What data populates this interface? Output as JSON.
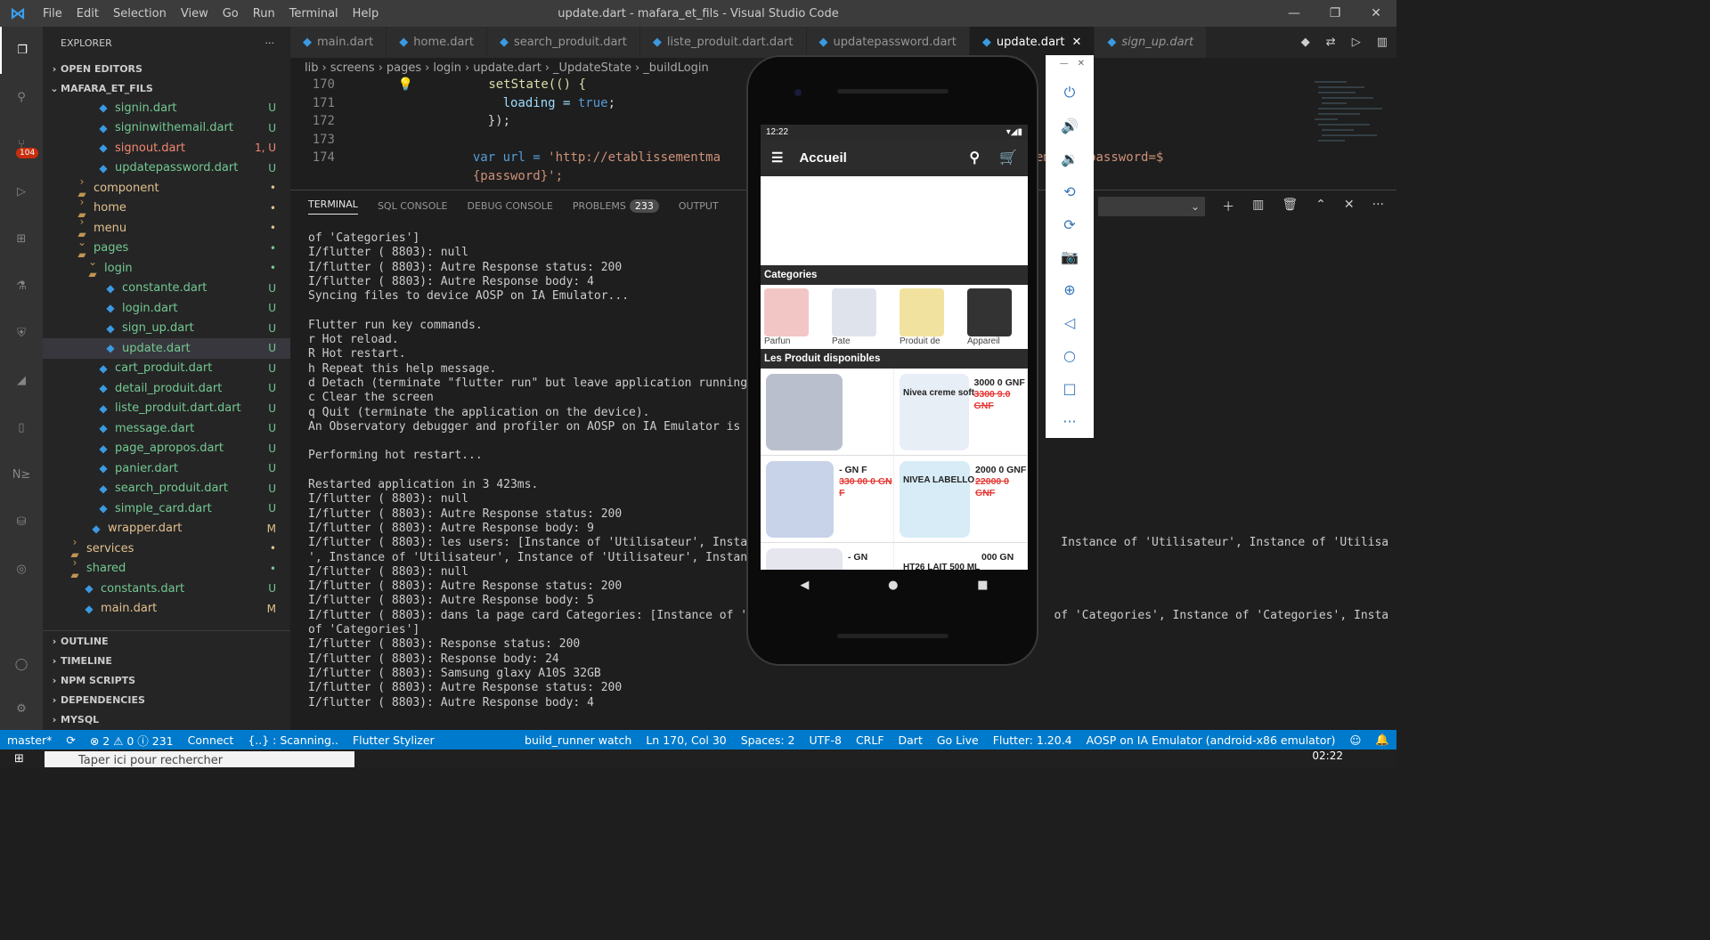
{
  "window": {
    "title": "update.dart - mafara_et_fils - Visual Studio Code",
    "menu": [
      "File",
      "Edit",
      "Selection",
      "View",
      "Go",
      "Run",
      "Terminal",
      "Help"
    ]
  },
  "activity": {
    "scm_badge": "104"
  },
  "explorer": {
    "header": "EXPLORER",
    "open_editors": "OPEN EDITORS",
    "project": "MAFARA_ET_FILS",
    "rows": [
      {
        "label": "signin.dart",
        "indent": 60,
        "type": "dart",
        "status": "U",
        "cls": "untracked"
      },
      {
        "label": "signinwithemail.dart",
        "indent": 60,
        "type": "dart",
        "status": "U",
        "cls": "untracked"
      },
      {
        "label": "signout.dart",
        "indent": 60,
        "type": "dart",
        "status": "1, U",
        "cls": "err"
      },
      {
        "label": "updatepassword.dart",
        "indent": 60,
        "type": "dart",
        "status": "U",
        "cls": "untracked"
      },
      {
        "label": "component",
        "indent": 36,
        "type": "folder",
        "status": "•",
        "cls": "modified"
      },
      {
        "label": "home",
        "indent": 36,
        "type": "folder",
        "status": "•",
        "cls": "modified"
      },
      {
        "label": "menu",
        "indent": 36,
        "type": "folder",
        "status": "•",
        "cls": "modified"
      },
      {
        "label": "pages",
        "indent": 36,
        "type": "folder-open",
        "status": "•",
        "cls": "untracked"
      },
      {
        "label": "login",
        "indent": 48,
        "type": "folder-open",
        "status": "•",
        "cls": "untracked"
      },
      {
        "label": "constante.dart",
        "indent": 68,
        "type": "dart",
        "status": "U",
        "cls": "untracked"
      },
      {
        "label": "login.dart",
        "indent": 68,
        "type": "dart",
        "status": "U",
        "cls": "untracked"
      },
      {
        "label": "sign_up.dart",
        "indent": 68,
        "type": "dart",
        "status": "U",
        "cls": "untracked"
      },
      {
        "label": "update.dart",
        "indent": 68,
        "type": "dart",
        "status": "U",
        "cls": "untracked",
        "selected": true
      },
      {
        "label": "cart_produit.dart",
        "indent": 60,
        "type": "dart",
        "status": "U",
        "cls": "untracked"
      },
      {
        "label": "detail_produit.dart",
        "indent": 60,
        "type": "dart",
        "status": "U",
        "cls": "untracked"
      },
      {
        "label": "liste_produit.dart.dart",
        "indent": 60,
        "type": "dart",
        "status": "U",
        "cls": "untracked"
      },
      {
        "label": "message.dart",
        "indent": 60,
        "type": "dart",
        "status": "U",
        "cls": "untracked"
      },
      {
        "label": "page_apropos.dart",
        "indent": 60,
        "type": "dart",
        "status": "U",
        "cls": "untracked"
      },
      {
        "label": "panier.dart",
        "indent": 60,
        "type": "dart",
        "status": "U",
        "cls": "untracked"
      },
      {
        "label": "search_produit.dart",
        "indent": 60,
        "type": "dart",
        "status": "U",
        "cls": "untracked"
      },
      {
        "label": "simple_card.dart",
        "indent": 60,
        "type": "dart",
        "status": "U",
        "cls": "untracked"
      },
      {
        "label": "wrapper.dart",
        "indent": 52,
        "type": "dart",
        "status": "M",
        "cls": "modified"
      },
      {
        "label": "services",
        "indent": 28,
        "type": "folder",
        "status": "•",
        "cls": "modified"
      },
      {
        "label": "shared",
        "indent": 28,
        "type": "folder",
        "status": "•",
        "cls": "untracked"
      },
      {
        "label": "constants.dart",
        "indent": 44,
        "type": "dart",
        "status": "U",
        "cls": "untracked"
      },
      {
        "label": "main.dart",
        "indent": 44,
        "type": "dart",
        "status": "M",
        "cls": "modified"
      }
    ],
    "bottom_sections": [
      "OUTLINE",
      "TIMELINE",
      "NPM SCRIPTS",
      "DEPENDENCIES",
      "MYSQL"
    ]
  },
  "tabs": [
    {
      "label": "main.dart",
      "active": false,
      "italic": false
    },
    {
      "label": "home.dart",
      "active": false,
      "italic": false
    },
    {
      "label": "search_produit.dart",
      "active": false,
      "italic": false
    },
    {
      "label": "liste_produit.dart.dart",
      "active": false,
      "italic": false
    },
    {
      "label": "updatepassword.dart",
      "active": false,
      "italic": false
    },
    {
      "label": "update.dart",
      "active": true,
      "italic": false
    },
    {
      "label": "sign_up.dart",
      "active": false,
      "italic": true
    }
  ],
  "breadcrumb": [
    "lib",
    "screens",
    "pages",
    "login",
    "update.dart",
    "_UpdateState",
    "_buildLogin"
  ],
  "code": {
    "lines": [
      "170",
      "171",
      "172",
      "173",
      "174"
    ],
    "l170": "setState(() {",
    "l171a": "loading = ",
    "l171b": "true",
    "l172": "});",
    "l174a": "var url = ",
    "l174b": "'http://etablissementma",
    "l174c": "il=${email}&password=$",
    "l175": "{password}';"
  },
  "panel": {
    "tabs": [
      "TERMINAL",
      "SQL CONSOLE",
      "DEBUG CONSOLE",
      "PROBLEMS",
      "OUTPUT"
    ],
    "problems_count": "233"
  },
  "terminal": [
    "of 'Categories']",
    "I/flutter ( 8803): null",
    "I/flutter ( 8803): Autre Response status: 200",
    "I/flutter ( 8803): Autre Response body: 4",
    "Syncing files to device AOSP on IA Emulator...                      34",
    "",
    "Flutter run key commands.",
    "r Hot reload.",
    "R Hot restart.",
    "h Repeat this help message.",
    "d Detach (terminate \"flutter run\" but leave application running).",
    "c Clear the screen",
    "q Quit (terminate the application on the device).",
    "An Observatory debugger and profiler on AOSP on IA Emulator is avai",
    "",
    "Performing hot restart...",
    "",
    "Restarted application in 3 423ms.",
    "I/flutter ( 8803): null",
    "I/flutter ( 8803): Autre Response status: 200",
    "I/flutter ( 8803): Autre Response body: 9",
    "I/flutter ( 8803): les users: [Instance of 'Utilisateur', Instance                                          Instance of 'Utilisateur', Instance of 'Utilisateur",
    "', Instance of 'Utilisateur', Instance of 'Utilisateur', Instance o",
    "I/flutter ( 8803): null",
    "I/flutter ( 8803): Autre Response status: 200",
    "I/flutter ( 8803): Autre Response body: 5",
    "I/flutter ( 8803): dans la page card Categories: [Instance of 'Cate                                        of 'Categories', Instance of 'Categories', Instance",
    "of 'Categories']",
    "I/flutter ( 8803): Response status: 200",
    "I/flutter ( 8803): Response body: 24",
    "I/flutter ( 8803): Samsung glaxy A10S 32GB",
    "I/flutter ( 8803): Autre Response status: 200",
    "I/flutter ( 8803): Autre Response body: 4"
  ],
  "statusbar": {
    "branch": "master*",
    "sync": "⟳",
    "problems": "⊗ 2 ⚠ 0 ⓘ 231",
    "connect": "Connect",
    "scanning": "{..} : Scanning..",
    "stylizer": "Flutter Stylizer",
    "build_runner": "build_runner watch",
    "position": "Ln 170, Col 30",
    "spaces": "Spaces: 2",
    "encoding": "UTF-8",
    "eol": "CRLF",
    "lang": "Dart",
    "golive": "Go Live",
    "flutter": "Flutter: 1.20.4",
    "device": "AOSP on IA Emulator (android-x86 emulator)"
  },
  "taskbar": {
    "search_placeholder": "Taper ici pour rechercher",
    "time": "02:22"
  },
  "phone": {
    "time": "12:22",
    "appbar_title": "Accueil",
    "categories_title": "Categories",
    "categories": [
      "Parfun",
      "Pate",
      "Produit de",
      "Appareil"
    ],
    "products_title": "Les Produit disponibles",
    "products": [
      {
        "name": "",
        "price": "",
        "old": ""
      },
      {
        "name": "Nivea creme soft",
        "price": "3000 0 GNF",
        "old": "3300 9.0 GNF"
      },
      {
        "name": "",
        "price": "- GN F",
        "old": "330 00 0 GN F"
      },
      {
        "name": "NIVEA  LABELLO",
        "price": "2000 0 GNF",
        "old": "22000 0 GNF"
      },
      {
        "name": "",
        "price": "- GN",
        "old": ""
      },
      {
        "name": "HT26 LAIT 500 ML",
        "price": "000 GN",
        "old": ""
      }
    ]
  }
}
